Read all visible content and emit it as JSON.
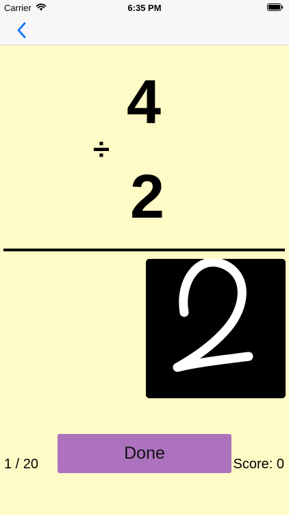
{
  "status_bar": {
    "carrier": "Carrier",
    "time": "6:35 PM",
    "icons": [
      "wifi-icon",
      "battery-icon"
    ]
  },
  "nav": {
    "back_icon": "chevron-left-icon",
    "accent_color": "#1a7cf5"
  },
  "problem": {
    "top_number": "4",
    "operator": "÷",
    "bottom_number": "2"
  },
  "draw_pad": {
    "handwritten_answer": "2",
    "background": "#000000",
    "stroke_color": "#ffffff"
  },
  "done_button": {
    "label": "Done",
    "color": "#ad72be"
  },
  "progress": "1 / 20",
  "score": "Score: 0",
  "background_color": "#fffbc6"
}
